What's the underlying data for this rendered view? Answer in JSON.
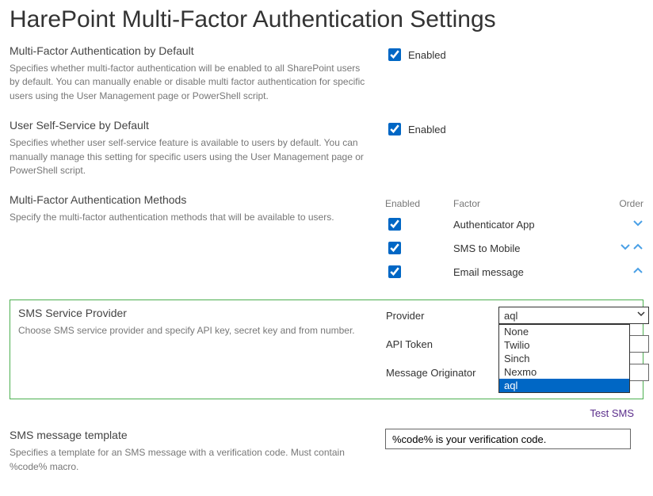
{
  "page": {
    "title": "HarePoint Multi-Factor Authentication Settings"
  },
  "mfa_default": {
    "heading": "Multi-Factor Authentication by Default",
    "desc": "Specifies whether multi-factor authentication will be enabled to all SharePoint users by default. You can manually enable or disable multi factor authentication for specific users using the User Management page or PowerShell script.",
    "checkbox_label": "Enabled",
    "checked": true
  },
  "self_service": {
    "heading": "User Self-Service by Default",
    "desc": "Specifies whether user self-service feature is available to users by default. You can manually manage this setting for specific users using the User Management page or PowerShell script.",
    "checkbox_label": "Enabled",
    "checked": true
  },
  "methods": {
    "heading": "Multi-Factor Authentication Methods",
    "desc": "Specify the multi-factor authentication methods that will be available to users.",
    "columns": {
      "enabled": "Enabled",
      "factor": "Factor",
      "order": "Order"
    },
    "rows": [
      {
        "enabled": true,
        "factor": "Authenticator App",
        "down": true,
        "up": false
      },
      {
        "enabled": true,
        "factor": "SMS to Mobile",
        "down": true,
        "up": true
      },
      {
        "enabled": true,
        "factor": "Email message",
        "down": false,
        "up": true
      }
    ]
  },
  "sms_provider": {
    "heading": "SMS Service Provider",
    "desc": "Choose SMS service provider and specify API key, secret key and from number.",
    "provider_label": "Provider",
    "provider_value": "aql",
    "provider_options": [
      "None",
      "Twilio",
      "Sinch",
      "Nexmo",
      "aql"
    ],
    "api_token_label": "API Token",
    "api_token_value": "",
    "originator_label": "Message Originator",
    "originator_value": ""
  },
  "test_sms": "Test SMS",
  "template": {
    "heading": "SMS message template",
    "desc": "Specifies a template for an SMS message with a verification code. Must contain %code% macro.",
    "value": "%code% is your verification code."
  }
}
